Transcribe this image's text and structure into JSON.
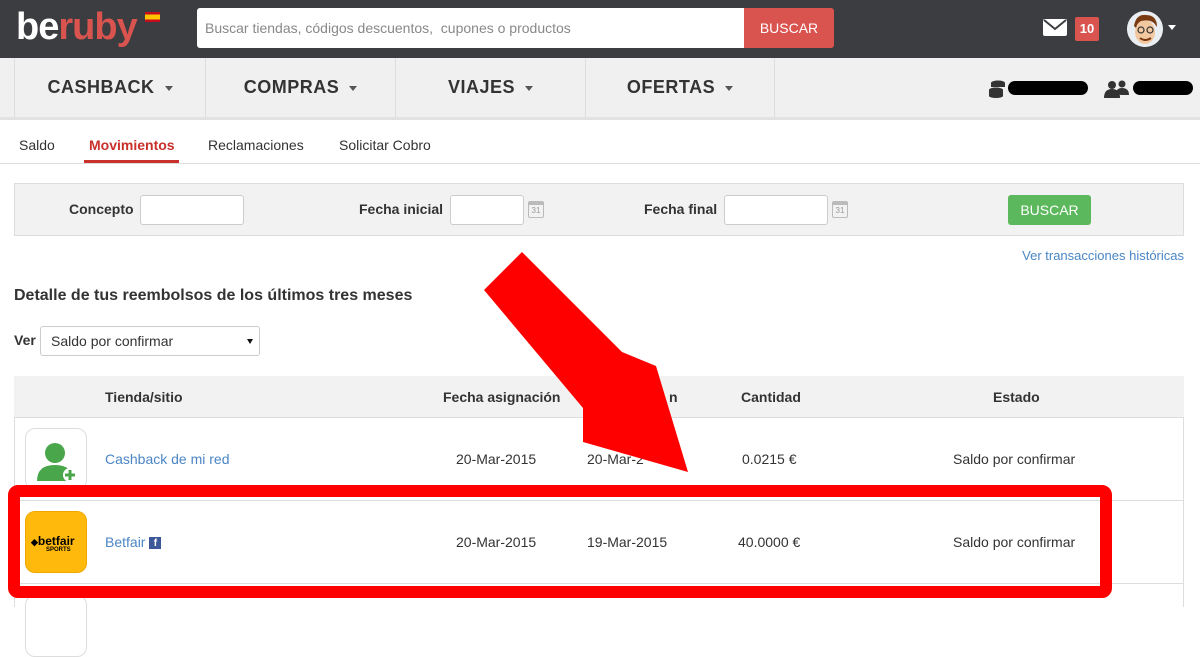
{
  "header": {
    "logo_part1": "be",
    "logo_part2": "ruby",
    "search_placeholder": "Buscar tiendas, códigos descuentos,  cupones o productos",
    "search_button": "BUSCAR",
    "messages_count": "10"
  },
  "nav": {
    "items": [
      {
        "label": "CASHBACK"
      },
      {
        "label": "COMPRAS"
      },
      {
        "label": "VIAJES"
      },
      {
        "label": "OFERTAS"
      }
    ]
  },
  "tabs": [
    {
      "label": "Saldo"
    },
    {
      "label": "Movimientos",
      "active": true
    },
    {
      "label": "Reclamaciones"
    },
    {
      "label": "Solicitar Cobro"
    }
  ],
  "filter": {
    "concepto_label": "Concepto",
    "fecha_inicial_label": "Fecha inicial",
    "fecha_final_label": "Fecha final",
    "calendar_day": "31",
    "button": "BUSCAR"
  },
  "historical_link": "Ver transacciones históricas",
  "section_title": "Detalle de tus reembolsos de los últimos tres meses",
  "ver": {
    "label": "Ver",
    "selected": "Saldo por confirmar"
  },
  "table": {
    "headers": {
      "tienda": "Tienda/sitio",
      "fecha_asignacion": "Fecha asignación",
      "fecha_other_partial": "n",
      "cantidad": "Cantidad",
      "estado": "Estado"
    },
    "rows": [
      {
        "store": "Cashback de mi red",
        "fecha_asignacion": "20-Mar-2015",
        "fecha_2": "20-Mar-2",
        "cantidad": "0.0215 €",
        "estado": "Saldo por confirmar"
      },
      {
        "store": "Betfair",
        "fecha_asignacion": "20-Mar-2015",
        "fecha_2": "19-Mar-2015",
        "cantidad": "40.0000 €",
        "estado": "Saldo por confirmar",
        "logo_text": "betfair",
        "logo_subtext": "SPORTS"
      }
    ]
  },
  "colors": {
    "topbar": "#3c3d41",
    "accent_red": "#d9534f",
    "green_button": "#5cb85c",
    "link_blue": "#4a86c5",
    "annotation_red": "#ff0000",
    "betfair_yellow": "#ffb80c"
  }
}
